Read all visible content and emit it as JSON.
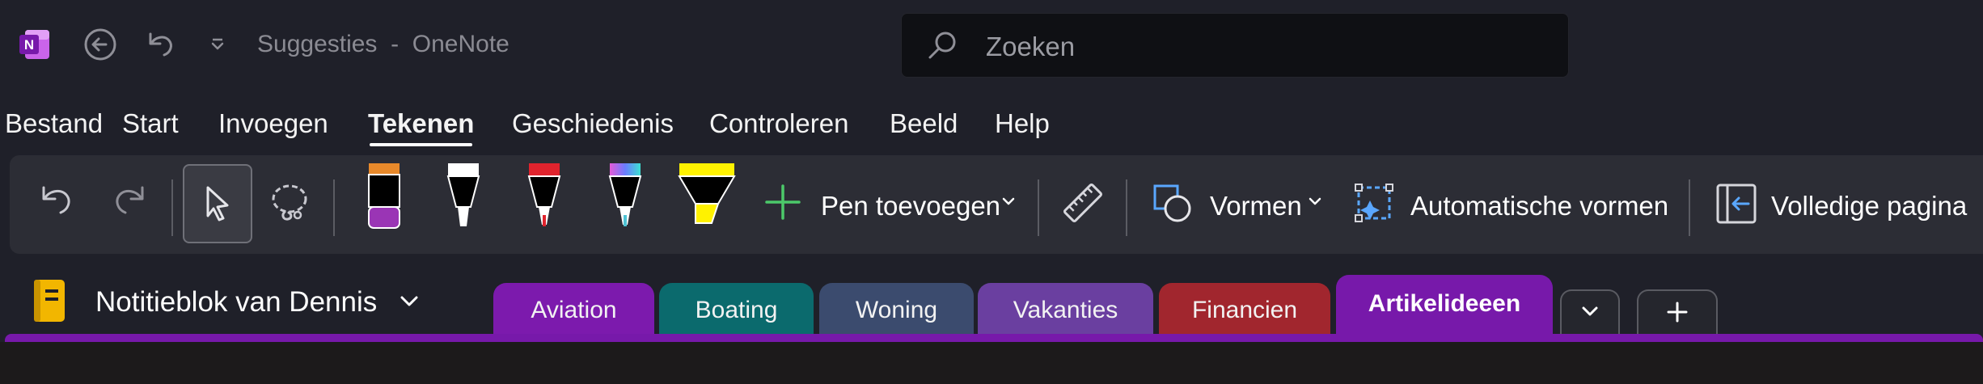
{
  "titlebar": {
    "app_icon": "onenote-logo",
    "app_letter": "N",
    "back_icon": "back-circle-icon",
    "undo_icon": "undo-icon",
    "customize_icon": "chevron-down-icon",
    "title": "Suggesties  -  OneNote"
  },
  "search": {
    "icon": "search-icon",
    "placeholder": "Zoeken"
  },
  "menu": {
    "items": [
      "Bestand",
      "Start",
      "Invoegen",
      "Tekenen",
      "Geschiedenis",
      "Controleren",
      "Beeld",
      "Help"
    ],
    "active": "Tekenen"
  },
  "ribbon": {
    "undo_icon": "undo-icon",
    "redo_icon": "redo-icon",
    "select_icon": "cursor-icon",
    "lasso_icon": "lasso-icon",
    "pens": [
      {
        "icon": "marker-icon",
        "tip": "#e8892a",
        "color": "#9a35b5"
      },
      {
        "icon": "pen-icon",
        "tip": "#ffffff",
        "color": "#ffffff"
      },
      {
        "icon": "pen-icon",
        "tip": "#e0232d",
        "color": "#e0232d"
      },
      {
        "icon": "pen-icon",
        "tip": "galaxy",
        "color": "#4fc3d4"
      },
      {
        "icon": "highlighter-icon",
        "tip": "#fff200",
        "color": "#fff200"
      }
    ],
    "add_pen_label": "Pen toevoegen",
    "ruler_icon": "ruler-icon",
    "shapes_label": "Vormen",
    "auto_shapes_label": "Automatische vormen",
    "full_page_label": "Volledige pagina"
  },
  "notebook": {
    "icon": "notebook-icon",
    "name": "Notitieblok van Dennis",
    "chevron": "chevron-down-icon"
  },
  "sections": [
    {
      "label": "Aviation",
      "color": "#7c1aad"
    },
    {
      "label": "Boating",
      "color": "#0b6a6d"
    },
    {
      "label": "Woning",
      "color": "#3b4b6e"
    },
    {
      "label": "Vakanties",
      "color": "#6a3fa0"
    },
    {
      "label": "Financien",
      "color": "#a1262e"
    },
    {
      "label": "Artikelideeen",
      "color": "#7719aa",
      "active": true
    }
  ],
  "section_controls": {
    "more_icon": "chevron-down-icon",
    "add_icon": "plus-icon"
  },
  "colors": {
    "accent": "#7719aa",
    "background": "#1f2029",
    "ribbon": "#2c2d35"
  }
}
